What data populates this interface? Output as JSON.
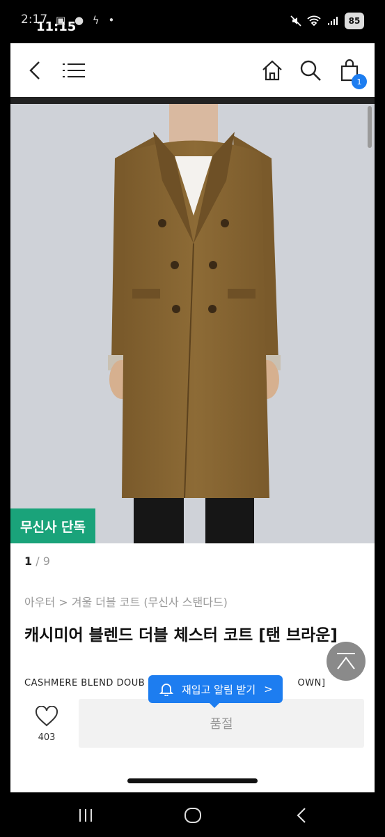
{
  "status_bar": {
    "time_back": "2:17",
    "time": "11:15",
    "left_icons": "▣ ● ϟ •",
    "battery": "85"
  },
  "header": {
    "icons": [
      "back-chevron-icon",
      "menu-icon",
      "home-icon",
      "search-icon",
      "cart-icon"
    ],
    "cart_count": "1"
  },
  "hero": {
    "exclusive_badge": "무신사 단독",
    "image": "model-wearing-brown-double-breasted-coat"
  },
  "pager": {
    "current": "1",
    "separator": "/",
    "total": "9"
  },
  "product": {
    "breadcrumb": "아우터 > 겨울 더블 코트 (무신사 스탠다드)",
    "title": "캐시미어 블렌드 더블 체스터 코트 [탠 브라운]",
    "subtitle_left": "CASHMERE BLEND DOUB",
    "subtitle_right": "OWN]"
  },
  "toast": {
    "label": "재입고 알림 받기",
    "arrow": ">"
  },
  "actions": {
    "like_count": "403",
    "soldout_label": "품절"
  },
  "colors": {
    "accent_blue": "#1d7df0",
    "badge_green": "#1aa37a",
    "coat": "#8a6a35"
  }
}
